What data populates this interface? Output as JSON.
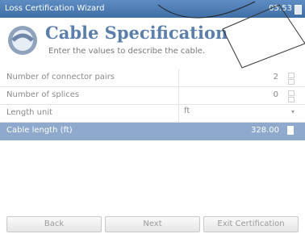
{
  "window": {
    "title": "Loss Certification Wizard",
    "time": "05:53"
  },
  "header": {
    "title": "Cable Specification",
    "subtitle": "Enter the values to describe the cable."
  },
  "form": {
    "rows": [
      {
        "label": "Number of connector pairs",
        "value": "2"
      },
      {
        "label": "Number of splices",
        "value": "0"
      },
      {
        "label": "Length unit",
        "value": "ft"
      },
      {
        "label": "Cable length (ft)",
        "value": "328.00"
      }
    ]
  },
  "footer": {
    "back": "Back",
    "next": "Next",
    "exit": "Exit Certification"
  },
  "colors": {
    "accent": "#5b7fab",
    "selected_row": "#8ea9cc",
    "titlebar": "#4a7ab0"
  }
}
